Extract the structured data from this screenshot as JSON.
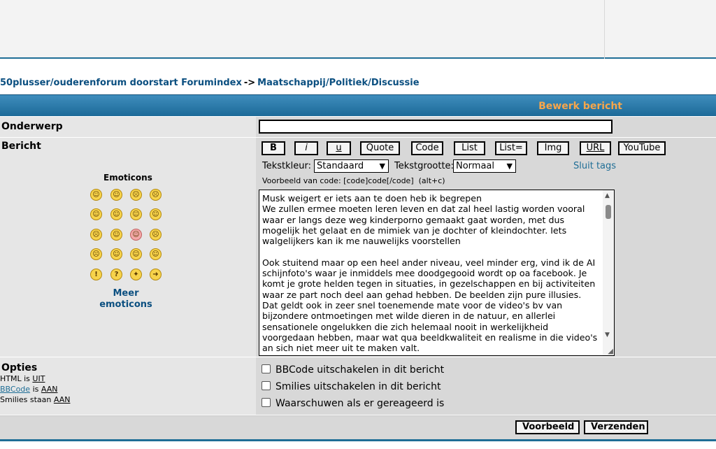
{
  "breadcrumb": {
    "home": "50plusser/ouderenforum doorstart Forumindex",
    "separator": "->",
    "forum": "Maatschappij/Politiek/Discussie"
  },
  "header": {
    "title": "Bewerk bericht"
  },
  "subject": {
    "label": "Onderwerp",
    "value": ""
  },
  "message": {
    "label": "Bericht"
  },
  "toolbar": {
    "bold": "B",
    "italic": "i",
    "underline": "u",
    "quote": "Quote",
    "code": "Code",
    "list": "List",
    "list_eq": "List=",
    "img": "Img",
    "url": "URL",
    "youtube": "YouTube",
    "text_color_label": "Tekstkleur:",
    "text_color_value": "Standaard",
    "text_size_label": "Tekstgrootte:",
    "text_size_value": "Normaal",
    "close_tags": "Sluit tags",
    "code_example": "Voorbeeld van code: [code]code[/code]  (alt+c)"
  },
  "emoticons": {
    "title": "Emoticons",
    "more": "Meer emoticons"
  },
  "body_text": "Musk weigert er iets aan te doen heb ik begrepen\nWe zullen ermee moeten leren leven en dat zal heel lastig worden vooral waar er langs deze weg kinderporno gemaakt gaat worden, met dus mogelijk het gelaat en de mimiek van je dochter of kleindochter. Iets walgelijkers kan ik me nauwelijks voorstellen\n\nOok stuitend maar op een heel ander niveau, veel minder erg, vind ik de AI schijnfoto's waar je inmiddels mee doodgegooid wordt op oa facebook. Je komt je grote helden tegen in situaties, in gezelschappen en bij activiteiten waar ze part noch deel aan gehad hebben. De beelden zijn pure illusies.\nDat geldt ook in zeer snel toenemende mate voor de video's bv van bijzondere ontmoetingen met wilde dieren in de natuur, en allerlei sensationele ongelukken die zich helemaal nooit in werkelijkheid voorgedaan hebben, maar wat qua beeldkwaliteit en realisme in die video's an sich niet meer uit te maken valt.",
  "options": {
    "label": "Opties",
    "html_prefix": "HTML is",
    "html_value": "UIT",
    "bbcode_link": "BBCode",
    "bbcode_mid": "is",
    "bbcode_value": "AAN",
    "smilies_prefix": "Smilies staan",
    "smilies_value": "AAN",
    "disable_bbcode": "BBCode uitschakelen in dit bericht",
    "disable_smilies": "Smilies uitschakelen in dit bericht",
    "notify": "Waarschuwen als er gereageerd is"
  },
  "buttons": {
    "preview": "Voorbeeld",
    "submit": "Verzenden"
  }
}
